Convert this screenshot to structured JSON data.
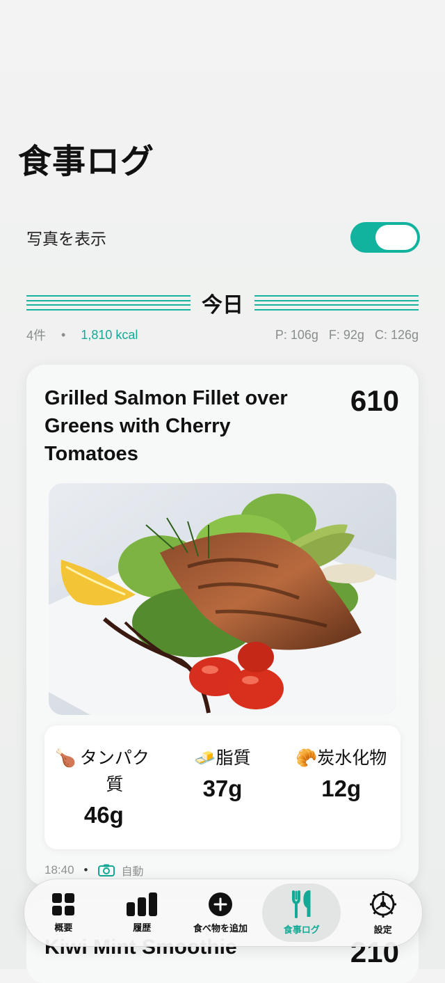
{
  "page": {
    "title": "食事ログ"
  },
  "photo_toggle": {
    "label": "写真を表示",
    "on": true
  },
  "day": {
    "label": "今日",
    "count": "4件",
    "kcal": "1,810 kcal",
    "protein": "P: 106g",
    "fat": "F: 92g",
    "carbs": "C: 126g"
  },
  "entries": [
    {
      "title": "Grilled Salmon Fillet over Greens with Cherry Tomatoes",
      "kcal": "610",
      "nutrients": [
        {
          "icon": "🍗",
          "label": "タンパク質",
          "value": "46g"
        },
        {
          "icon": "🧈",
          "label": "脂質",
          "value": "37g"
        },
        {
          "icon": "🥐",
          "label": "炭水化物",
          "value": "12g"
        }
      ],
      "time": "18:40",
      "source": "自動"
    },
    {
      "title": "Kiwi Mint Smoothie",
      "kcal": "210"
    }
  ],
  "tabs": [
    {
      "label": "概要",
      "icon": "grid-icon"
    },
    {
      "label": "履歴",
      "icon": "bar-chart-icon"
    },
    {
      "label": "食べ物を追加",
      "icon": "plus-circle-icon"
    },
    {
      "label": "食事ログ",
      "icon": "fork-knife-icon",
      "active": true
    },
    {
      "label": "設定",
      "icon": "gear-icon"
    }
  ],
  "colors": {
    "accent": "#14a996",
    "background": "#f2f3f2"
  }
}
